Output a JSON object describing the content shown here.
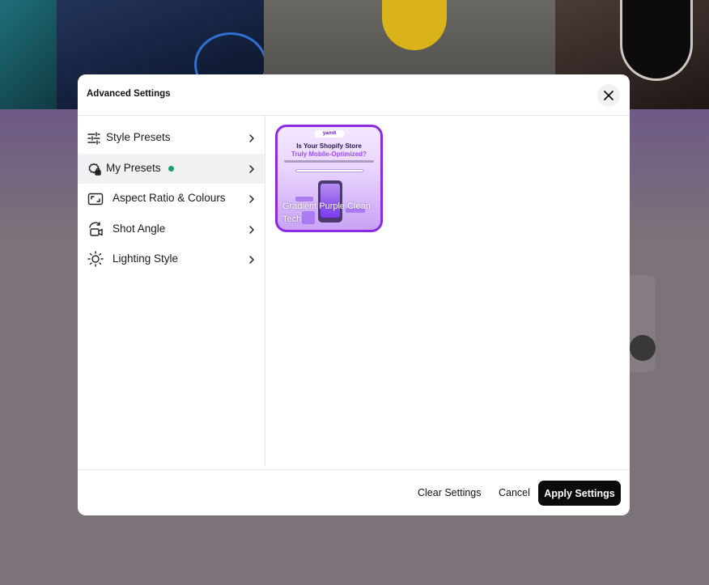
{
  "modal": {
    "title": "Advanced Settings",
    "close_icon": "close-icon"
  },
  "sidebar": {
    "items": [
      {
        "label": "Style Presets",
        "icon": "sliders-icon",
        "active": false
      },
      {
        "label": "My Presets",
        "icon": "preset-lock-icon",
        "active": true,
        "status": "green-dot"
      },
      {
        "label": "Aspect Ratio & Colours",
        "icon": "aspect-ratio-icon",
        "active": false
      },
      {
        "label": "Shot Angle",
        "icon": "camera-rotate-icon",
        "active": false
      },
      {
        "label": "Lighting Style",
        "icon": "sun-icon",
        "active": false
      }
    ]
  },
  "presets": [
    {
      "name": "Gradient Purple Clean Tech",
      "thumbnail": {
        "brand": "yarnit",
        "headline": "Is Your Shopify Store",
        "headline_accent": "Truly Mobile-Optimized?"
      }
    }
  ],
  "footer": {
    "clear_label": "Clear Settings",
    "cancel_label": "Cancel",
    "apply_label": "Apply Settings"
  },
  "colors": {
    "accent_purple": "#8a2be2",
    "status_green": "#1e9e6a",
    "primary_button": "#0b0b0b"
  }
}
